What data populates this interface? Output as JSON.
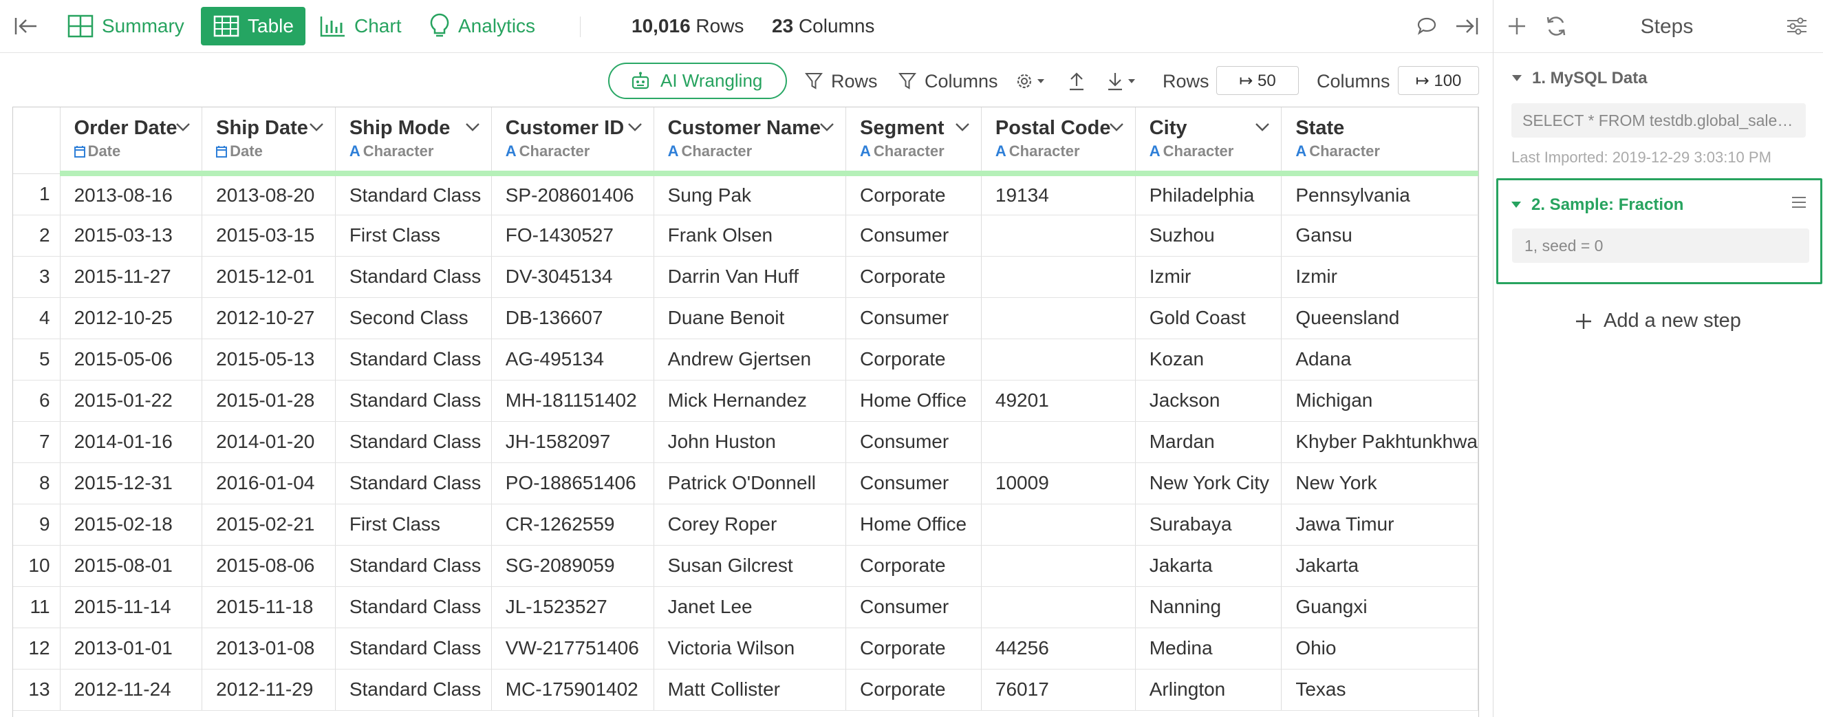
{
  "header": {
    "tabs": [
      {
        "label": "Summary"
      },
      {
        "label": "Table"
      },
      {
        "label": "Chart"
      },
      {
        "label": "Analytics"
      }
    ],
    "row_count": "10,016",
    "row_word": "Rows",
    "col_count": "23",
    "col_word": "Columns"
  },
  "toolbar": {
    "ai_label": "AI Wrangling",
    "rows_filter": "Rows",
    "cols_filter": "Columns",
    "rows_label": "Rows",
    "rows_value": "↦ 50",
    "cols_label": "Columns",
    "cols_value": "↦ 100"
  },
  "columns": [
    {
      "name": "Order Date",
      "type": "Date",
      "type_icon": "calendar-icon"
    },
    {
      "name": "Ship Date",
      "type": "Date",
      "type_icon": "calendar-icon"
    },
    {
      "name": "Ship Mode",
      "type": "Character",
      "type_icon": "character-icon"
    },
    {
      "name": "Customer ID",
      "type": "Character",
      "type_icon": "character-icon"
    },
    {
      "name": "Customer Name",
      "type": "Character",
      "type_icon": "character-icon"
    },
    {
      "name": "Segment",
      "type": "Character",
      "type_icon": "character-icon"
    },
    {
      "name": "Postal Code",
      "type": "Character",
      "type_icon": "character-icon"
    },
    {
      "name": "City",
      "type": "Character",
      "type_icon": "character-icon"
    },
    {
      "name": "State",
      "type": "Character",
      "type_icon": "character-icon"
    }
  ],
  "rows": [
    [
      "1",
      "2013-08-16",
      "2013-08-20",
      "Standard Class",
      "SP-208601406",
      "Sung Pak",
      "Corporate",
      "19134",
      "Philadelphia",
      "Pennsylvania"
    ],
    [
      "2",
      "2015-03-13",
      "2015-03-15",
      "First Class",
      "FO-1430527",
      "Frank Olsen",
      "Consumer",
      "",
      "Suzhou",
      "Gansu"
    ],
    [
      "3",
      "2015-11-27",
      "2015-12-01",
      "Standard Class",
      "DV-3045134",
      "Darrin Van Huff",
      "Corporate",
      "",
      "Izmir",
      "Izmir"
    ],
    [
      "4",
      "2012-10-25",
      "2012-10-27",
      "Second Class",
      "DB-136607",
      "Duane Benoit",
      "Consumer",
      "",
      "Gold Coast",
      "Queensland"
    ],
    [
      "5",
      "2015-05-06",
      "2015-05-13",
      "Standard Class",
      "AG-495134",
      "Andrew Gjertsen",
      "Corporate",
      "",
      "Kozan",
      "Adana"
    ],
    [
      "6",
      "2015-01-22",
      "2015-01-28",
      "Standard Class",
      "MH-181151402",
      "Mick Hernandez",
      "Home Office",
      "49201",
      "Jackson",
      "Michigan"
    ],
    [
      "7",
      "2014-01-16",
      "2014-01-20",
      "Standard Class",
      "JH-1582097",
      "John Huston",
      "Consumer",
      "",
      "Mardan",
      "Khyber Pakhtunkhwa"
    ],
    [
      "8",
      "2015-12-31",
      "2016-01-04",
      "Standard Class",
      "PO-188651406",
      "Patrick O'Donnell",
      "Consumer",
      "10009",
      "New York City",
      "New York"
    ],
    [
      "9",
      "2015-02-18",
      "2015-02-21",
      "First Class",
      "CR-1262559",
      "Corey Roper",
      "Home Office",
      "",
      "Surabaya",
      "Jawa Timur"
    ],
    [
      "10",
      "2015-08-01",
      "2015-08-06",
      "Standard Class",
      "SG-2089059",
      "Susan Gilcrest",
      "Corporate",
      "",
      "Jakarta",
      "Jakarta"
    ],
    [
      "11",
      "2015-11-14",
      "2015-11-18",
      "Standard Class",
      "JL-1523527",
      "Janet Lee",
      "Consumer",
      "",
      "Nanning",
      "Guangxi"
    ],
    [
      "12",
      "2013-01-01",
      "2013-01-08",
      "Standard Class",
      "VW-217751406",
      "Victoria Wilson",
      "Corporate",
      "44256",
      "Medina",
      "Ohio"
    ],
    [
      "13",
      "2012-11-24",
      "2012-11-29",
      "Standard Class",
      "MC-175901402",
      "Matt Collister",
      "Corporate",
      "76017",
      "Arlington",
      "Texas"
    ]
  ],
  "steps": {
    "title": "Steps",
    "step1_title": "1. MySQL Data",
    "step1_query": "SELECT * FROM testdb.global_sales_data",
    "step1_time": "Last Imported: 2019-12-29 3:03:10 PM",
    "step2_title": "2. Sample: Fraction",
    "step2_body": "1, seed = 0",
    "add_step": "Add a new step"
  },
  "colors": {
    "accent": "#25a562",
    "header_underline": "#b5f0b8",
    "type_icon": "#2e7fd8"
  }
}
